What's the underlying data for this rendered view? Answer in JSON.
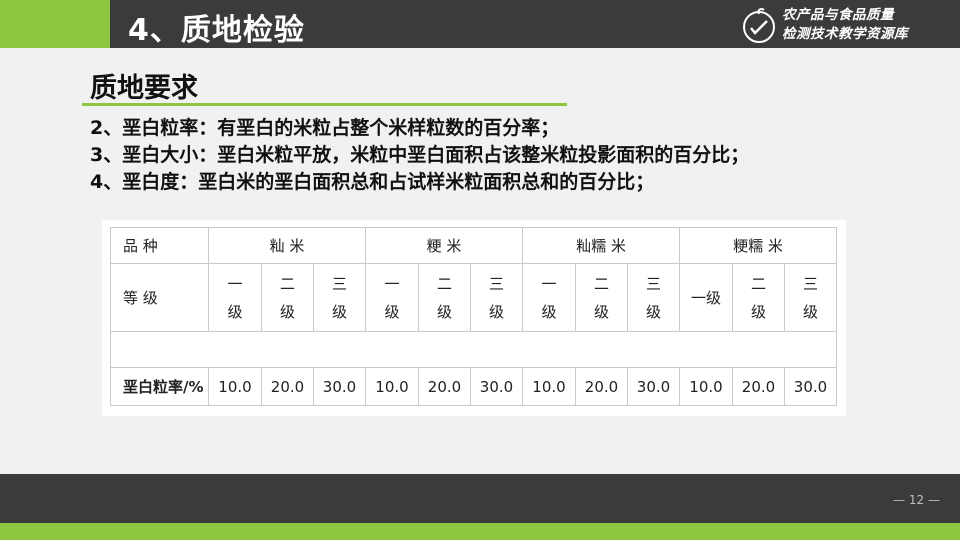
{
  "header": {
    "section_title": "4、质地检验",
    "logo_line1": "农产品与食品质量",
    "logo_line2": "检测技术教学资源库"
  },
  "subtitle": "质地要求",
  "points": [
    "2、垩白粒率：有垩白的米粒占整个米样粒数的百分率；",
    "3、垩白大小：垩白米粒平放，米粒中垩白面积占该整米粒投影面积的百分比；",
    "4、垩白度：垩白米的垩白面积总和占试样米粒面积总和的百分比；"
  ],
  "table": {
    "row_labels": {
      "variety": "品 种",
      "grade": "等 级",
      "chalky_rate": "垩白粒率/%"
    },
    "varieties": [
      "籼 米",
      "粳 米",
      "籼糯 米",
      "粳糯 米"
    ],
    "grades": [
      [
        "一\n级",
        "二\n级",
        "三\n级"
      ],
      [
        "一\n级",
        "二\n级",
        "三\n级"
      ],
      [
        "一\n级",
        "二\n级",
        "三\n级"
      ],
      [
        "一级",
        "二\n级",
        "三\n级"
      ]
    ],
    "values": [
      "10.0",
      "20.0",
      "30.0",
      "10.0",
      "20.0",
      "30.0",
      "10.0",
      "20.0",
      "30.0",
      "10.0",
      "20.0",
      "30.0"
    ]
  },
  "footer": {
    "page_number": "— 12 —"
  },
  "colors": {
    "accent_green": "#8dc63f",
    "bar_dark": "#3b3b3b",
    "background": "#f1f1f1"
  }
}
